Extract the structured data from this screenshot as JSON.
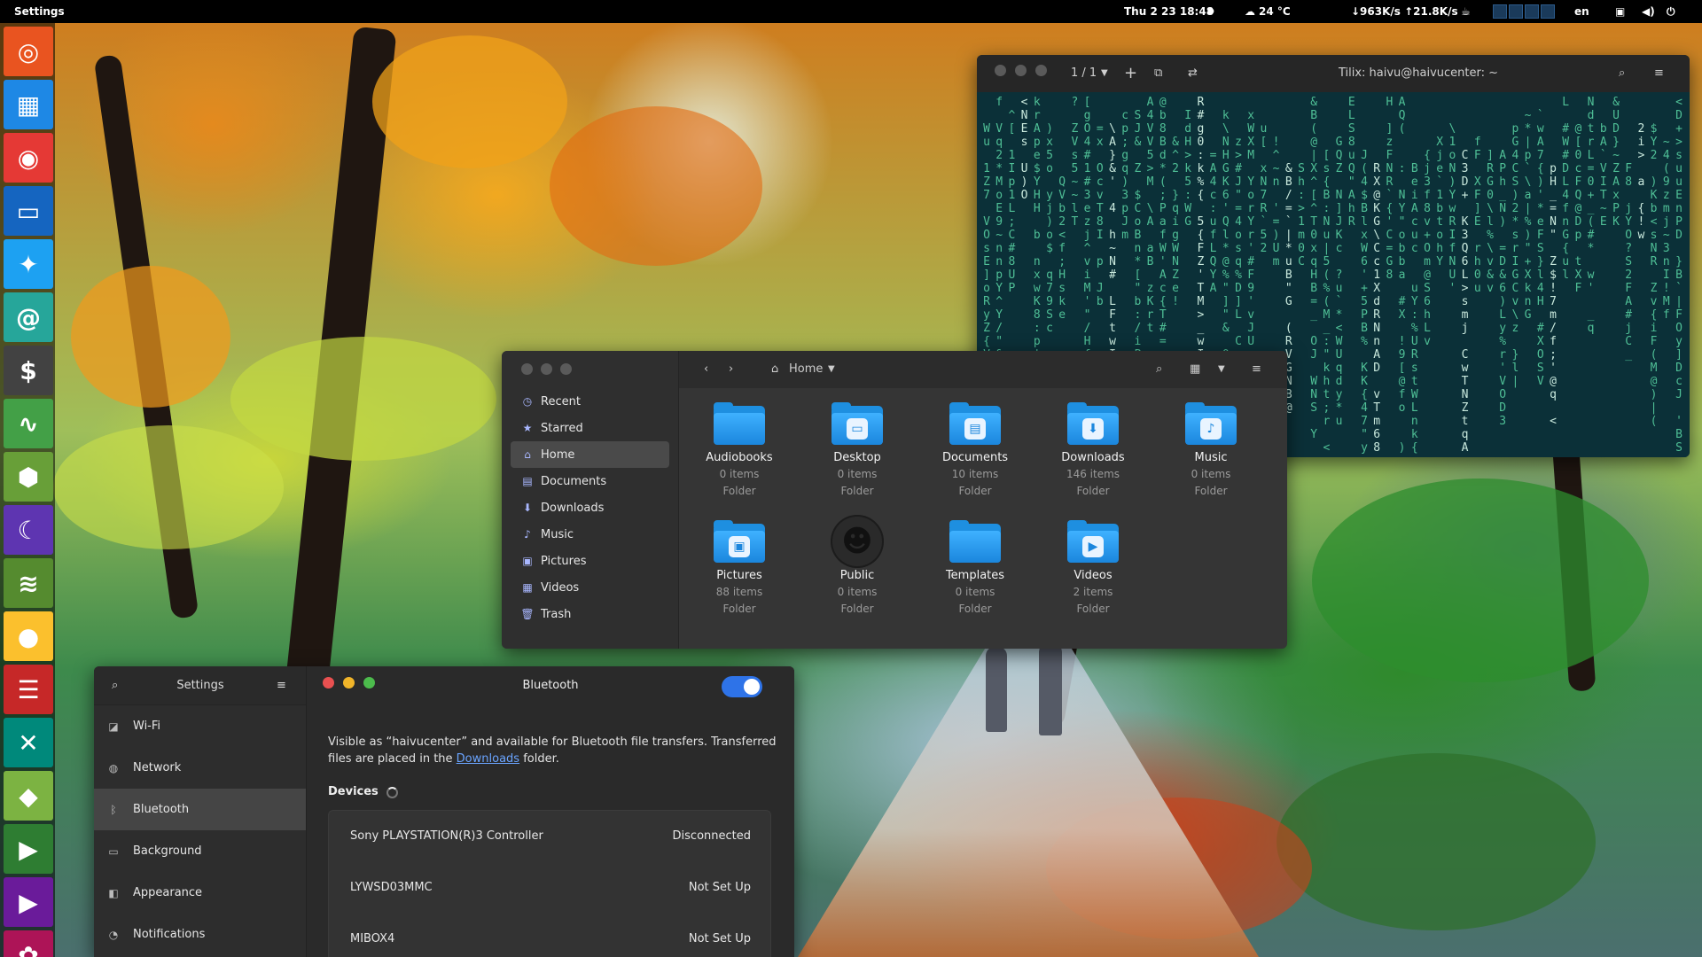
{
  "topbar": {
    "app_name": "Settings",
    "datetime": "Thu 2 23  18:48",
    "weather": "24 °C",
    "net_speed": "↓963K/s ↑21.8K/s",
    "language": "en"
  },
  "dock": {
    "items": [
      {
        "name": "ubuntu",
        "glyph": "◎",
        "color": "#e95420"
      },
      {
        "name": "windows-tiles",
        "glyph": "▦",
        "color": "#1e88e5"
      },
      {
        "name": "chrome",
        "glyph": "◉",
        "color": "#e53935"
      },
      {
        "name": "files",
        "glyph": "▭",
        "color": "#1565c0"
      },
      {
        "name": "twitter",
        "glyph": "✦",
        "color": "#1da1f2"
      },
      {
        "name": "mail",
        "glyph": "@",
        "color": "#26a69a"
      },
      {
        "name": "terminal",
        "glyph": "$",
        "color": "#424242"
      },
      {
        "name": "system-monitor",
        "glyph": "∿",
        "color": "#43a047"
      },
      {
        "name": "software",
        "glyph": "⬢",
        "color": "#689f38"
      },
      {
        "name": "thunderbird",
        "glyph": "☾",
        "color": "#5e35b1"
      },
      {
        "name": "network",
        "glyph": "≋",
        "color": "#558b2f"
      },
      {
        "name": "chat",
        "glyph": "●",
        "color": "#fbc02d"
      },
      {
        "name": "news",
        "glyph": "☰",
        "color": "#c62828"
      },
      {
        "name": "crossover",
        "glyph": "✕",
        "color": "#00897b"
      },
      {
        "name": "games",
        "glyph": "◆",
        "color": "#7cb342"
      },
      {
        "name": "video",
        "glyph": "▶",
        "color": "#2e7d32"
      },
      {
        "name": "player",
        "glyph": "▶",
        "color": "#6a1b9a"
      },
      {
        "name": "extra",
        "glyph": "✿",
        "color": "#ad1457"
      }
    ]
  },
  "terminal": {
    "tab_counter": "1 / 1",
    "title": "Tilix: haivu@haivucenter: ~"
  },
  "files": {
    "location": "Home",
    "sidebar": [
      {
        "label": "Recent",
        "icon": "clock-icon",
        "glyph": "◷"
      },
      {
        "label": "Starred",
        "icon": "star-icon",
        "glyph": "★"
      },
      {
        "label": "Home",
        "icon": "home-icon",
        "glyph": "⌂"
      },
      {
        "label": "Documents",
        "icon": "document-icon",
        "glyph": "▤"
      },
      {
        "label": "Downloads",
        "icon": "download-icon",
        "glyph": "⬇"
      },
      {
        "label": "Music",
        "icon": "music-icon",
        "glyph": "♪"
      },
      {
        "label": "Pictures",
        "icon": "picture-icon",
        "glyph": "▣"
      },
      {
        "label": "Videos",
        "icon": "video-icon",
        "glyph": "▦"
      },
      {
        "label": "Trash",
        "icon": "trash-icon",
        "glyph": "🗑"
      }
    ],
    "selected": "Home",
    "folders": [
      {
        "name": "Audiobooks",
        "count": "0 items",
        "type": "Folder",
        "emblem": ""
      },
      {
        "name": "Desktop",
        "count": "0 items",
        "type": "Folder",
        "emblem": "▭"
      },
      {
        "name": "Documents",
        "count": "10 items",
        "type": "Folder",
        "emblem": "▤"
      },
      {
        "name": "Downloads",
        "count": "146 items",
        "type": "Folder",
        "emblem": "⬇"
      },
      {
        "name": "Music",
        "count": "0 items",
        "type": "Folder",
        "emblem": "♪"
      },
      {
        "name": "Pictures",
        "count": "88 items",
        "type": "Folder",
        "emblem": "▣"
      },
      {
        "name": "Public",
        "count": "0 items",
        "type": "Folder",
        "emblem": "public"
      },
      {
        "name": "Templates",
        "count": "0 items",
        "type": "Folder",
        "emblem": ""
      },
      {
        "name": "Videos",
        "count": "2 items",
        "type": "Folder",
        "emblem": "▶"
      }
    ]
  },
  "settings": {
    "title": "Settings",
    "panel_title": "Bluetooth",
    "bluetooth_enabled": true,
    "sidebar": [
      {
        "label": "Wi-Fi",
        "icon": "wifi-icon",
        "glyph": "◪"
      },
      {
        "label": "Network",
        "icon": "network-icon",
        "glyph": "◍"
      },
      {
        "label": "Bluetooth",
        "icon": "bluetooth-icon",
        "glyph": "ᛒ"
      },
      {
        "label": "Background",
        "icon": "background-icon",
        "glyph": "▭"
      },
      {
        "label": "Appearance",
        "icon": "appearance-icon",
        "glyph": "◧"
      },
      {
        "label": "Notifications",
        "icon": "notifications-icon",
        "glyph": "◔"
      }
    ],
    "selected": "Bluetooth",
    "description_before": "Visible as “haivucenter” and available for Bluetooth file transfers. Transferred files are placed in the ",
    "description_link": "Downloads",
    "description_after": " folder.",
    "devices_label": "Devices",
    "devices": [
      {
        "name": "Sony PLAYSTATION(R)3 Controller",
        "status": "Disconnected"
      },
      {
        "name": "LYWSD03MMC",
        "status": "Not Set Up"
      },
      {
        "name": "MIBOX4",
        "status": "Not Set Up"
      }
    ]
  }
}
